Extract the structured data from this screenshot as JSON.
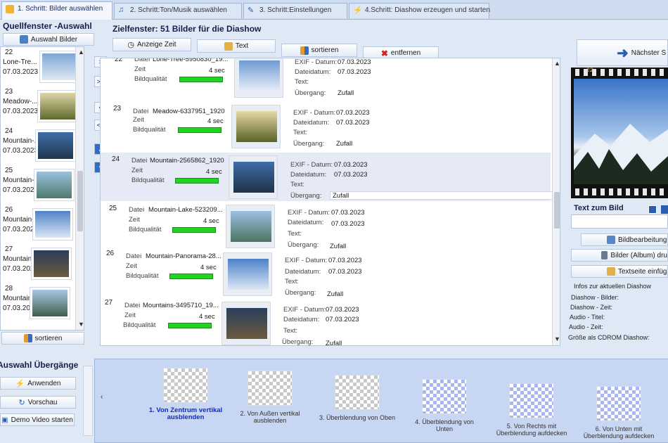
{
  "tabs": [
    {
      "label": "1. Schritt: Bilder auswählen"
    },
    {
      "label": "2. Schritt:Ton/Musik auswählen"
    },
    {
      "label": "3. Schritt:Einstellungen"
    },
    {
      "label": "4.Schritt: Diashow erzeugen und starten"
    }
  ],
  "source": {
    "title": "Quellfenster -Auswahl",
    "select_button": "Auswahl Bilder",
    "sort_button": "sortieren",
    "items": [
      {
        "num": "22",
        "name": "Lone-Tre...",
        "date": "07.03.2023"
      },
      {
        "num": "23",
        "name": "Meadow-...",
        "date": "07.03.2023"
      },
      {
        "num": "24",
        "name": "Mountain-...",
        "date": "07.03.2023"
      },
      {
        "num": "25",
        "name": "Mountain-...",
        "date": "07.03.2023"
      },
      {
        "num": "26",
        "name": "Mountain-...",
        "date": "07.03.2023"
      },
      {
        "num": "27",
        "name": "Mountain-...",
        "date": "07.03.2023"
      },
      {
        "num": "28",
        "name": "Mountain-...",
        "date": "07.03.2023"
      }
    ]
  },
  "move_buttons": [
    ">",
    ">>",
    "<",
    "<<"
  ],
  "target": {
    "title": "Zielfenster: 51 Bilder für die Diashow",
    "toolbar": {
      "show_time": "Anzeige Zeit",
      "text": "Text",
      "sort": "sortieren",
      "remove": "entfernen"
    },
    "labels": {
      "file": "Datei",
      "time": "Zeit",
      "quality": "Bildqualität",
      "exif": "EXIF - Datum:",
      "filedate": "Dateidatum:",
      "text": "Text:",
      "transition": "Übergang:"
    },
    "rows": [
      {
        "num": "22",
        "file": "Lone-Tree-5950830_19...",
        "time": "4 sec",
        "quality": 1.0,
        "exif": "07.03.2023",
        "filedate": "07.03.2023",
        "text": "",
        "transition": "Zufall"
      },
      {
        "num": "23",
        "file": "Meadow-6337951_1920",
        "time": "4 sec",
        "quality": 1.0,
        "exif": "07.03.2023",
        "filedate": "07.03.2023",
        "text": "",
        "transition": "Zufall"
      },
      {
        "num": "24",
        "file": "Mountain-2565862_1920",
        "time": "4 sec",
        "quality": 1.0,
        "exif": "07.03.2023",
        "filedate": "07.03.2023",
        "text": "",
        "transition": "Zufall"
      },
      {
        "num": "25",
        "file": "Mountain-Lake-523209...",
        "time": "4 sec",
        "quality": 1.0,
        "exif": "07.03.2023",
        "filedate": "07.03.2023",
        "text": "",
        "transition": "Zufall"
      },
      {
        "num": "26",
        "file": "Mountain-Panorama-28...",
        "time": "4 sec",
        "quality": 1.0,
        "exif": "07.03.2023",
        "filedate": "07.03.2023",
        "text": "",
        "transition": "Zufall"
      },
      {
        "num": "27",
        "file": "Mountains-3495710_19...",
        "time": "4 sec",
        "quality": 1.0,
        "exif": "07.03.2023",
        "filedate": "07.03.2023",
        "text": "",
        "transition": "Zufall"
      }
    ]
  },
  "right": {
    "next_button": "Nächster S",
    "film_frame": "22",
    "text_to_image": "Text zum Bild",
    "edit_button": "Bildbearbeitung",
    "print_button": "Bilder (Album) dru",
    "textpage_button": "Textseite einfüg",
    "info_title": "Infos zur aktuellen Diashow",
    "info_lines": [
      "Diashow - Bilder:",
      "Diashow - Zeit:",
      "Audio - Titel:",
      "Audio - Zeit:",
      "Größe als CDROM Diashow:"
    ]
  },
  "transitions": {
    "title": "Auswahl Übergänge",
    "apply_button": "Anwenden",
    "preview_button": "Vorschau",
    "demo_button": "Demo Video starten",
    "items": [
      {
        "label": "1. Von Zentrum vertikal ausblenden"
      },
      {
        "label": "2. Von Außen vertikal ausblenden"
      },
      {
        "label": "3. Überblendung von Oben"
      },
      {
        "label": "4. Überblendung von Unten"
      },
      {
        "label": "5. Von Rechts mit Überblendung aufdecken"
      },
      {
        "label": "6. Von Unten mit Überblendung aufdecken"
      }
    ]
  }
}
